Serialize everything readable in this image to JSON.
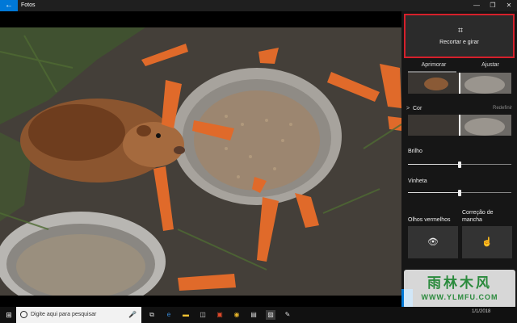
{
  "window": {
    "title": "Fotos",
    "back_glyph": "←",
    "minimize_glyph": "—",
    "maximize_glyph": "❐",
    "close_glyph": "✕"
  },
  "editor": {
    "crop_button": {
      "icon": "crop-rotate-icon",
      "label": "Recortar e girar"
    },
    "tabs": [
      {
        "label": "Aprimorar",
        "selected": true
      },
      {
        "label": "Ajustar",
        "selected": false
      }
    ],
    "color_section": {
      "chevron": ">",
      "label": "Cor",
      "reset_label": "Redefinir"
    },
    "sliders": [
      {
        "label": "Brilho",
        "value": 0.5
      },
      {
        "label": "Vinheta",
        "value": 0.5
      }
    ],
    "tools": [
      {
        "label": "Olhos vermelhos",
        "icon": "eye-icon",
        "glyph": "👁"
      },
      {
        "label": "Correção de mancha",
        "icon": "touch-hand-icon",
        "glyph": "☝"
      }
    ]
  },
  "watermark": {
    "text": "雨林木风",
    "url": "WWW.YLMFU.COM"
  },
  "taskbar": {
    "start_icon": "windows-logo-icon",
    "search_placeholder": "Digite aqui para pesquisar",
    "icons": [
      "task-view-icon",
      "edge-icon",
      "file-explorer-icon",
      "store-icon",
      "office-icon",
      "chrome-icon",
      "sticky-notes-icon",
      "photos-icon",
      "paint-icon"
    ],
    "clock": "1/1/2018"
  },
  "colors": {
    "accent": "#0078d7",
    "highlight_border": "#d6202b",
    "panel_bg": "#161616",
    "watermark_green": "#2a8a3c"
  }
}
